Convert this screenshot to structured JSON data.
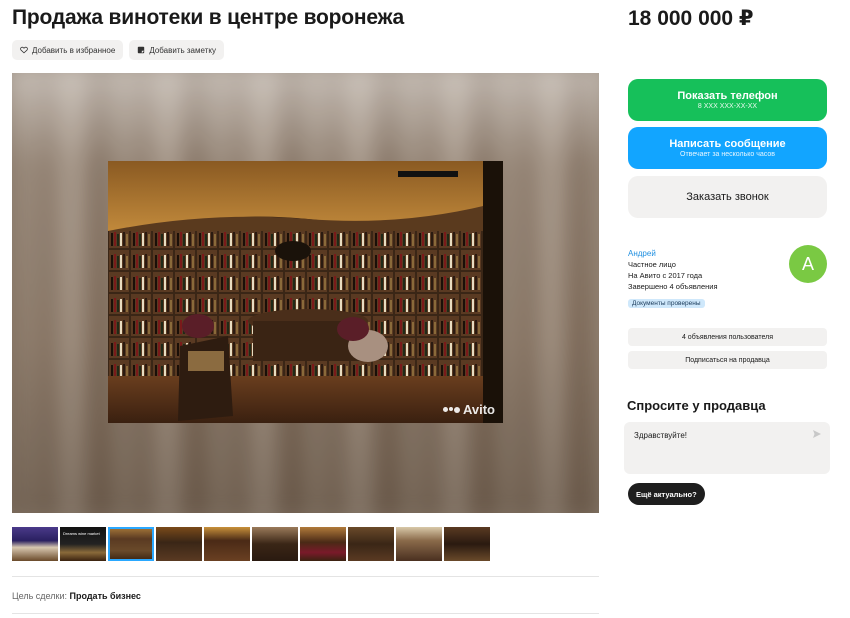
{
  "listing": {
    "title": "Продажа винотеки в центре воронежа",
    "price": "18 000 000 ₽"
  },
  "actions": {
    "favorite_label": "Добавить в избранное",
    "note_label": "Добавить заметку"
  },
  "gallery": {
    "watermark": "Avito",
    "thumbnails": [
      {
        "label": ""
      },
      {
        "label": "Dreams wine market"
      },
      {
        "label": ""
      },
      {
        "label": ""
      },
      {
        "label": ""
      },
      {
        "label": ""
      },
      {
        "label": ""
      },
      {
        "label": ""
      },
      {
        "label": ""
      },
      {
        "label": ""
      }
    ],
    "active_thumbnail": 3
  },
  "deal": {
    "label": "Цель сделки:",
    "value": "Продать бизнес"
  },
  "contact": {
    "phone_label": "Показать телефон",
    "phone_sub": "8 XXX XXX-XX-XX",
    "message_label": "Написать сообщение",
    "message_sub": "Отвечает за несколько часов",
    "callback_label": "Заказать звонок"
  },
  "seller": {
    "name": "Андрей",
    "type": "Частное лицо",
    "since": "На Авито с 2017 года",
    "completed": "Завершено 4 объявления",
    "docs_badge": "Документы проверены",
    "avatar_letter": "А",
    "listings_link": "4 объявления пользователя",
    "subscribe_label": "Подписаться на продавца"
  },
  "ask": {
    "title": "Спросите у продавца",
    "message_value": "Здравствуйте!",
    "quick_reply": "Ещё актуально?"
  },
  "colors": {
    "green": "#16c05a",
    "blue": "#12a5ff",
    "avatar": "#7ac943"
  }
}
